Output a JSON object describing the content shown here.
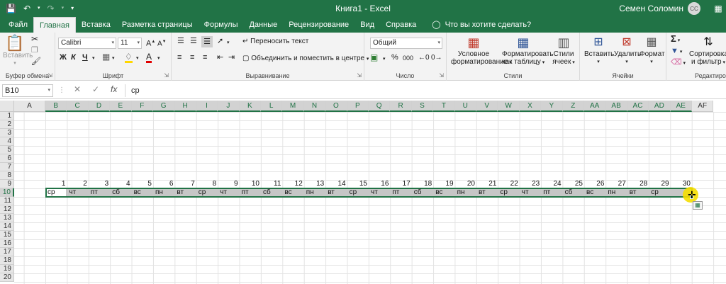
{
  "window": {
    "title": "Книга1  -  Excel",
    "user_name": "Семен Соломин",
    "user_initials": "СС"
  },
  "tabs": [
    "Файл",
    "Главная",
    "Вставка",
    "Разметка страницы",
    "Формулы",
    "Данные",
    "Рецензирование",
    "Вид",
    "Справка"
  ],
  "tell_me": "Что вы хотите сделать?",
  "ribbon": {
    "clipboard": {
      "label": "Буфер обмена",
      "paste": "Вставить"
    },
    "font": {
      "label": "Шрифт",
      "name": "Calibri",
      "size": "11",
      "bold": "Ж",
      "italic": "К",
      "underline": "Ч"
    },
    "alignment": {
      "label": "Выравнивание",
      "wrap_text": "Переносить текст",
      "merge_center": "Объединить и поместить в центре"
    },
    "number": {
      "label": "Число",
      "format": "Общий",
      "percent": "%",
      "thousands": "000"
    },
    "styles": {
      "label": "Стили",
      "conditional_l1": "Условное",
      "conditional_l2": "форматирование",
      "as_table_l1": "Форматировать",
      "as_table_l2": "как таблицу",
      "cell_styles_l1": "Стили",
      "cell_styles_l2": "ячеек"
    },
    "cells": {
      "label": "Ячейки",
      "insert": "Вставить",
      "delete": "Удалить",
      "format": "Формат"
    },
    "editing": {
      "label": "Редактирова",
      "sort_l1": "Сортировка",
      "sort_l2": "и фильтр"
    }
  },
  "formula_bar": {
    "name_box": "B10",
    "content": "ср"
  },
  "sheet": {
    "columns": [
      "A",
      "B",
      "C",
      "D",
      "E",
      "F",
      "G",
      "H",
      "I",
      "J",
      "K",
      "L",
      "M",
      "N",
      "O",
      "P",
      "Q",
      "R",
      "S",
      "T",
      "U",
      "V",
      "W",
      "X",
      "Y",
      "Z",
      "AA",
      "AB",
      "AC",
      "AD",
      "AE",
      "AF"
    ],
    "rows": [
      "1",
      "2",
      "3",
      "4",
      "5",
      "6",
      "7",
      "8",
      "9",
      "10",
      "11",
      "12",
      "13",
      "14",
      "15",
      "16",
      "17",
      "18",
      "19",
      "20"
    ],
    "row9_numbers": [
      "1",
      "2",
      "3",
      "4",
      "5",
      "6",
      "7",
      "8",
      "9",
      "10",
      "11",
      "12",
      "13",
      "14",
      "15",
      "16",
      "17",
      "18",
      "19",
      "20",
      "21",
      "22",
      "23",
      "24",
      "25",
      "26",
      "27",
      "28",
      "29",
      "30"
    ],
    "row10_days": [
      "ср",
      "чт",
      "пт",
      "сб",
      "вс",
      "пн",
      "вт",
      "ср",
      "чт",
      "пт",
      "сб",
      "вс",
      "пн",
      "вт",
      "ср",
      "чт",
      "пт",
      "сб",
      "вс",
      "пн",
      "вт",
      "ср",
      "чт",
      "пт",
      "сб",
      "вс",
      "пн",
      "вт",
      "ср"
    ],
    "active_cell": "B10"
  },
  "colors": {
    "excel_green": "#217346",
    "ribbon_bg": "#f3f3f3",
    "selection_gray": "#c6c6c6",
    "cursor_highlight": "#f5de00"
  }
}
